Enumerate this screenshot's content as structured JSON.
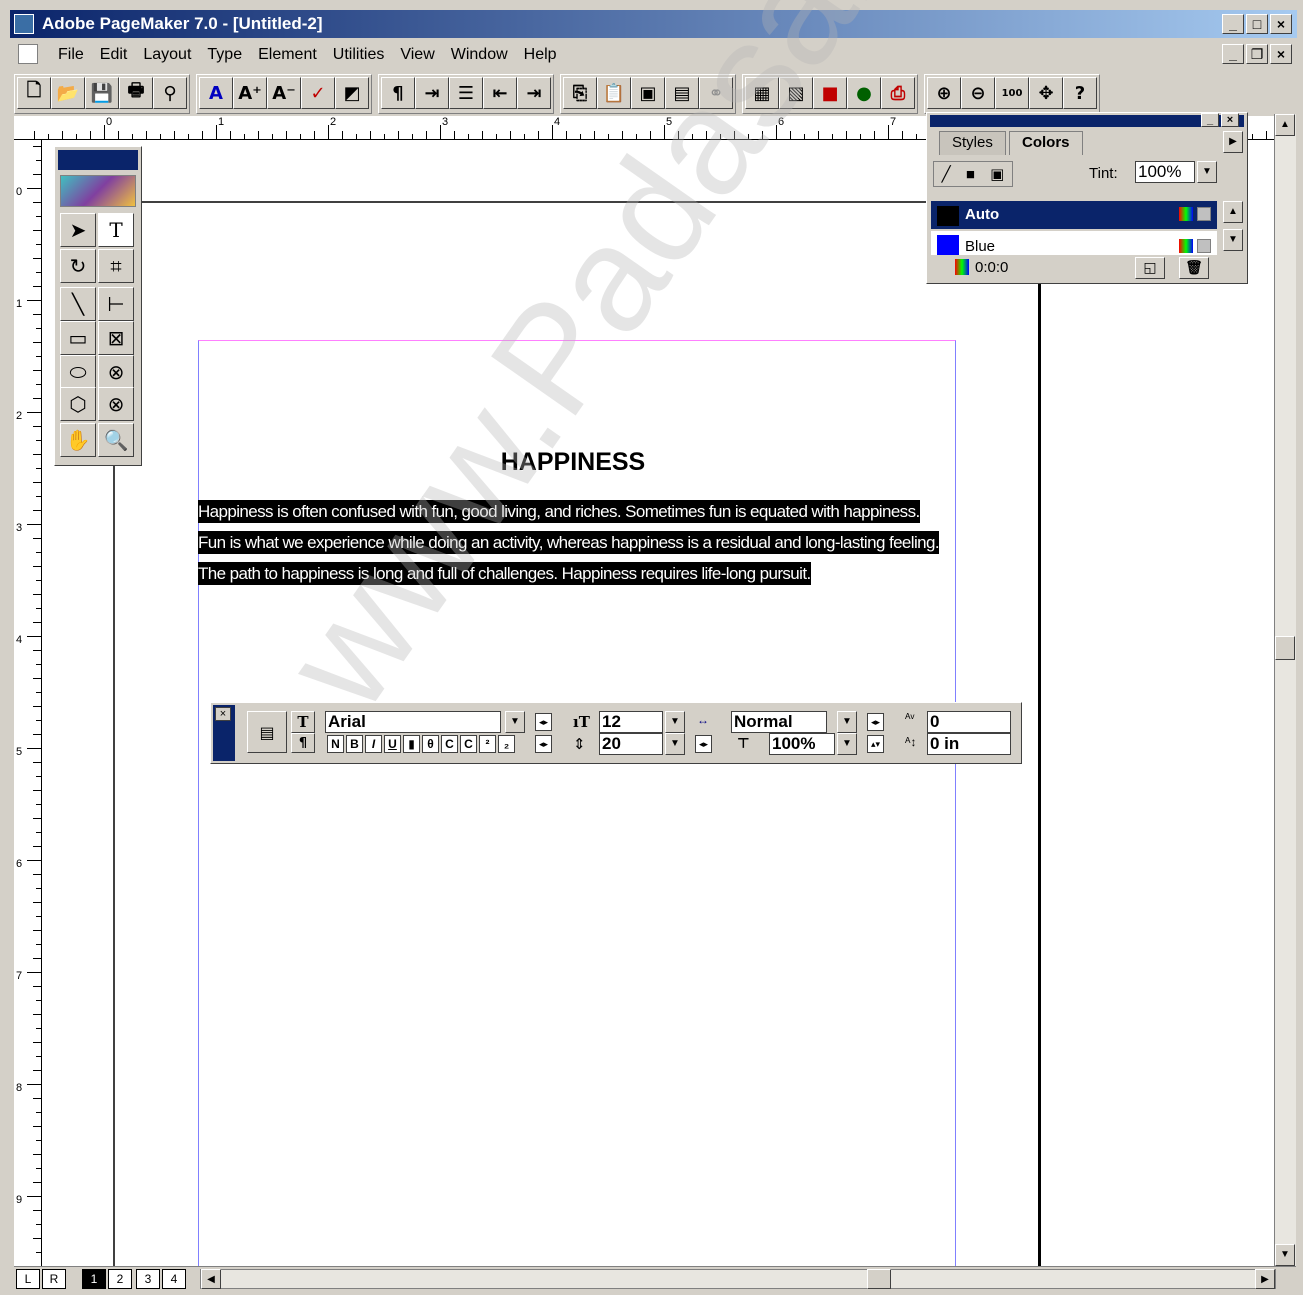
{
  "window": {
    "title": "Adobe PageMaker 7.0 - [Untitled-2]"
  },
  "menu": [
    "File",
    "Edit",
    "Layout",
    "Type",
    "Element",
    "Utilities",
    "View",
    "Window",
    "Help"
  ],
  "toolbar_icons": [
    "new-icon",
    "open-icon",
    "save-icon",
    "print-icon",
    "find-icon",
    "font-icon",
    "font-larger-icon",
    "font-smaller-icon",
    "spellcheck-icon",
    "fill-icon",
    "paragraph-icon",
    "indent-icon",
    "bullets-icon",
    "decrease-indent-icon",
    "increase-indent-icon",
    "copy-icon",
    "paste-icon",
    "place-icon",
    "frame-icon",
    "link-icon",
    "image-icon",
    "image2-icon",
    "color-icon",
    "globe-icon",
    "pdf-icon",
    "zoom-in-icon",
    "zoom-out-icon",
    "actual-size-icon",
    "fit-icon",
    "help-icon"
  ],
  "ruler": {
    "horizontal": [
      "0",
      "1",
      "2",
      "3",
      "4",
      "5",
      "6",
      "7"
    ],
    "vertical": [
      "0",
      "1",
      "2",
      "3",
      "4",
      "5",
      "6",
      "7",
      "8",
      "9"
    ]
  },
  "document": {
    "heading": "HAPPINESS",
    "body": "Happiness is often confused with fun, good living, and riches. Sometimes fun is equated with happiness. Fun is what we experience while doing an activity, whereas happiness is a residual and long-lasting feeling. The path to happiness is long and full of challenges. Happiness requires life-long pursuit."
  },
  "colors_palette": {
    "tabs": [
      "Styles",
      "Colors"
    ],
    "tint_label": "Tint:",
    "tint_value": "100%",
    "colors": [
      {
        "name": "Auto",
        "swatch": "#000000",
        "selected": true
      },
      {
        "name": "Blue",
        "swatch": "#0000ff",
        "selected": false
      }
    ],
    "status": "0:0:0"
  },
  "control_palette": {
    "font": "Arial",
    "size": "12",
    "leading": "20",
    "style": "Normal",
    "scale": "100%",
    "kerning": "0",
    "baseline": "0 in",
    "style_buttons": [
      "N",
      "B",
      "I",
      "U",
      "",
      "",
      "C",
      "C",
      "",
      ""
    ]
  },
  "pages": [
    "L",
    "R",
    "1",
    "2",
    "3",
    "4"
  ],
  "current_page": "1",
  "watermark": "www.Padasalai.Net",
  "colors": {
    "titlebar": "#0a246a",
    "selection": "#000000",
    "margin_guide": "#ff80ff",
    "column_guide": "#8080ff"
  }
}
